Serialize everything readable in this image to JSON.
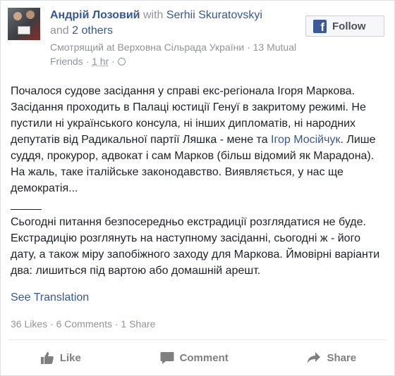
{
  "post": {
    "author": "Андрій Лозовий",
    "with_word": "with",
    "tagged_person": "Serhii Skuratovskyi",
    "and_word": "and",
    "others": "2 others",
    "activity_verb": "Смотрящий at",
    "place": "Верховна Сільрада України",
    "mutual": "· 13 Mutual",
    "friends": "Friends ·",
    "time": "1 hr",
    "time_sep": "·",
    "paragraph1_a": "Почалося судове засідання у справі екс-регіонала Ігоря Маркова. Засідання проходить в Палаці юстиції Генуї в закритому режимі. Не пустили ні українського консула, ні інших дипломатів, ні народних депутатів від Радикальної партії Ляшка - мене та ",
    "paragraph1_link": "Ігор Мосійчук",
    "paragraph1_b": ". Лише суддя, прокурор, адвокат і сам Марков (більш відомий як Марадона). На жаль, таке італійське законодавство. Виявляється, у нас ще демократія...",
    "paragraph2": "Сьогодні питання безпосередньо екстрадиції розглядатися не буде. Екстрадицію розглянуть на наступному засіданні, сьогодні ж - його дату, а також міру запобіжного заходу для Маркова. Ймовірні варіанти два: лишиться під вартою або домашній арешт.",
    "see_translation": "See Translation"
  },
  "follow": {
    "label": "Follow",
    "logo": "f"
  },
  "stats": {
    "likes": "36 Likes",
    "sep1": "·",
    "comments": "6 Comments",
    "sep2": "·",
    "shares": "1 Share"
  },
  "actions": {
    "like": "Like",
    "comment": "Comment",
    "share": "Share"
  },
  "colors": {
    "link": "#365899",
    "muted": "#90949c",
    "text": "#1d2129",
    "facebook_blue": "#3b5998"
  }
}
